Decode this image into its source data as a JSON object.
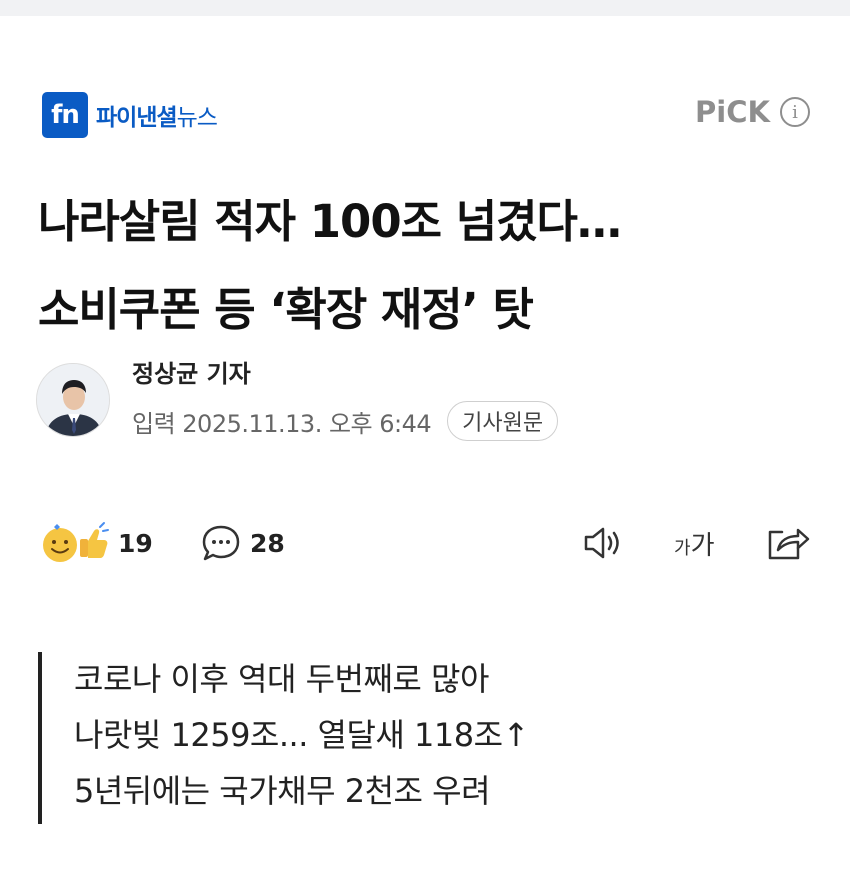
{
  "press": {
    "logo_mark": "fn",
    "name_main": "파이낸셜",
    "name_sub": "뉴스"
  },
  "pick": {
    "label": "PiCK",
    "info_icon": "info-icon"
  },
  "article": {
    "headline_line1": "나라살림 적자 100조 넘겼다…",
    "headline_line2": "소비쿠폰 등 ‘확장 재정’ 탓",
    "author_name": "정상균 기자",
    "date": "입력 2025.11.13. 오후 6:44",
    "source_button": "기사원문"
  },
  "actions": {
    "reaction_icon": "smile-thumbs-up-icon",
    "reaction_count": "19",
    "comment_icon": "comment-bubble-icon",
    "comment_count": "28",
    "speaker_icon": "speaker-icon",
    "fontsize_small": "가",
    "fontsize_large": "가",
    "share_icon": "share-icon"
  },
  "summary": [
    "코로나 이후 역대 두번째로 많아",
    "나랏빚 1259조... 열달새 118조↑",
    "5년뒤에는 국가채무 2천조 우려"
  ],
  "colors": {
    "brand": "#0a5bc4",
    "muted": "#8e8e8e"
  }
}
